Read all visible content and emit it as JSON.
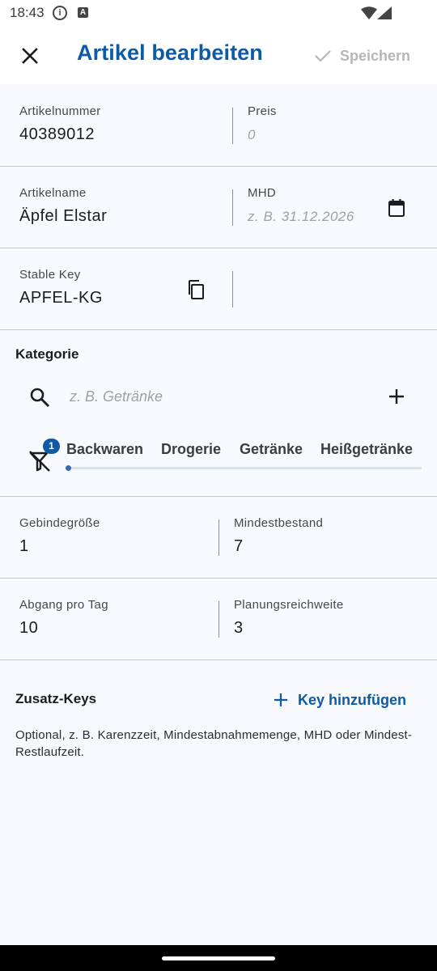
{
  "status_bar": {
    "time": "18:43",
    "info_glyph": "i",
    "app_glyph": "A"
  },
  "app_bar": {
    "title": "Artikel bearbeiten",
    "save_label": "Speichern"
  },
  "fields": {
    "artikelnummer": {
      "label": "Artikelnummer",
      "value": "40389012"
    },
    "preis": {
      "label": "Preis",
      "placeholder": "0"
    },
    "artikelname": {
      "label": "Artikelname",
      "value": "Äpfel Elstar"
    },
    "mhd": {
      "label": "MHD",
      "placeholder": "z. B. 31.12.2026"
    },
    "stable_key": {
      "label": "Stable Key",
      "value": "APFEL-KG"
    },
    "gebindegroesse": {
      "label": "Gebindegröße",
      "value": "1"
    },
    "mindestbestand": {
      "label": "Mindestbestand",
      "value": "7"
    },
    "abgang_pro_tag": {
      "label": "Abgang pro Tag",
      "value": "10"
    },
    "planungsreichweite": {
      "label": "Planungsreichweite",
      "value": "3"
    }
  },
  "kategorie": {
    "title": "Kategorie",
    "search_placeholder": "z. B. Getränke",
    "filter_badge": "1",
    "chips": [
      "Backwaren",
      "Drogerie",
      "Getränke",
      "Heißgetränke"
    ]
  },
  "zusatz": {
    "title": "Zusatz-Keys",
    "add_label": "Key hinzufügen",
    "helper": "Optional, z. B. Karenzzeit, Mindestabnahmemenge, MHD oder Mindest-Restlaufzeit."
  },
  "colors": {
    "accent": "#0d5ba6",
    "background": "#f8f9fd",
    "divider": "#c4c6cc",
    "disabled": "#b4b6bc"
  }
}
